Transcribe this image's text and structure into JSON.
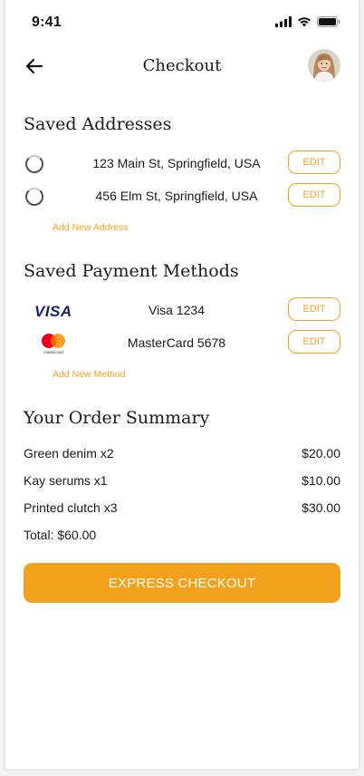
{
  "status_bar": {
    "time": "9:41"
  },
  "header": {
    "title": "Checkout"
  },
  "addresses": {
    "title": "Saved Addresses",
    "items": [
      {
        "text": "123 Main St, Springfield, USA",
        "edit_label": "EDIT"
      },
      {
        "text": "456 Elm St, Springfield, USA",
        "edit_label": "EDIT"
      }
    ],
    "add_label": "Add New Address"
  },
  "payments": {
    "title": "Saved Payment Methods",
    "items": [
      {
        "logo": "VISA",
        "text": "Visa 1234",
        "edit_label": "EDIT"
      },
      {
        "logo_caption": "mastercard",
        "text": "MasterCard 5678",
        "edit_label": "EDIT"
      }
    ],
    "add_label": "Add New Method"
  },
  "order": {
    "title": "Your Order Summary",
    "items": [
      {
        "name": "Green denim x2",
        "price": "$20.00"
      },
      {
        "name": "Kay serums x1",
        "price": "$10.00"
      },
      {
        "name": "Printed clutch x3",
        "price": "$30.00"
      }
    ],
    "total": "Total: $60.00"
  },
  "checkout_button": {
    "label": "EXPRESS CHECKOUT"
  },
  "colors": {
    "accent": "#f2a11d",
    "visa_blue": "#1a1f71",
    "mc_red": "#eb001b",
    "mc_orange": "#f79e1b"
  }
}
